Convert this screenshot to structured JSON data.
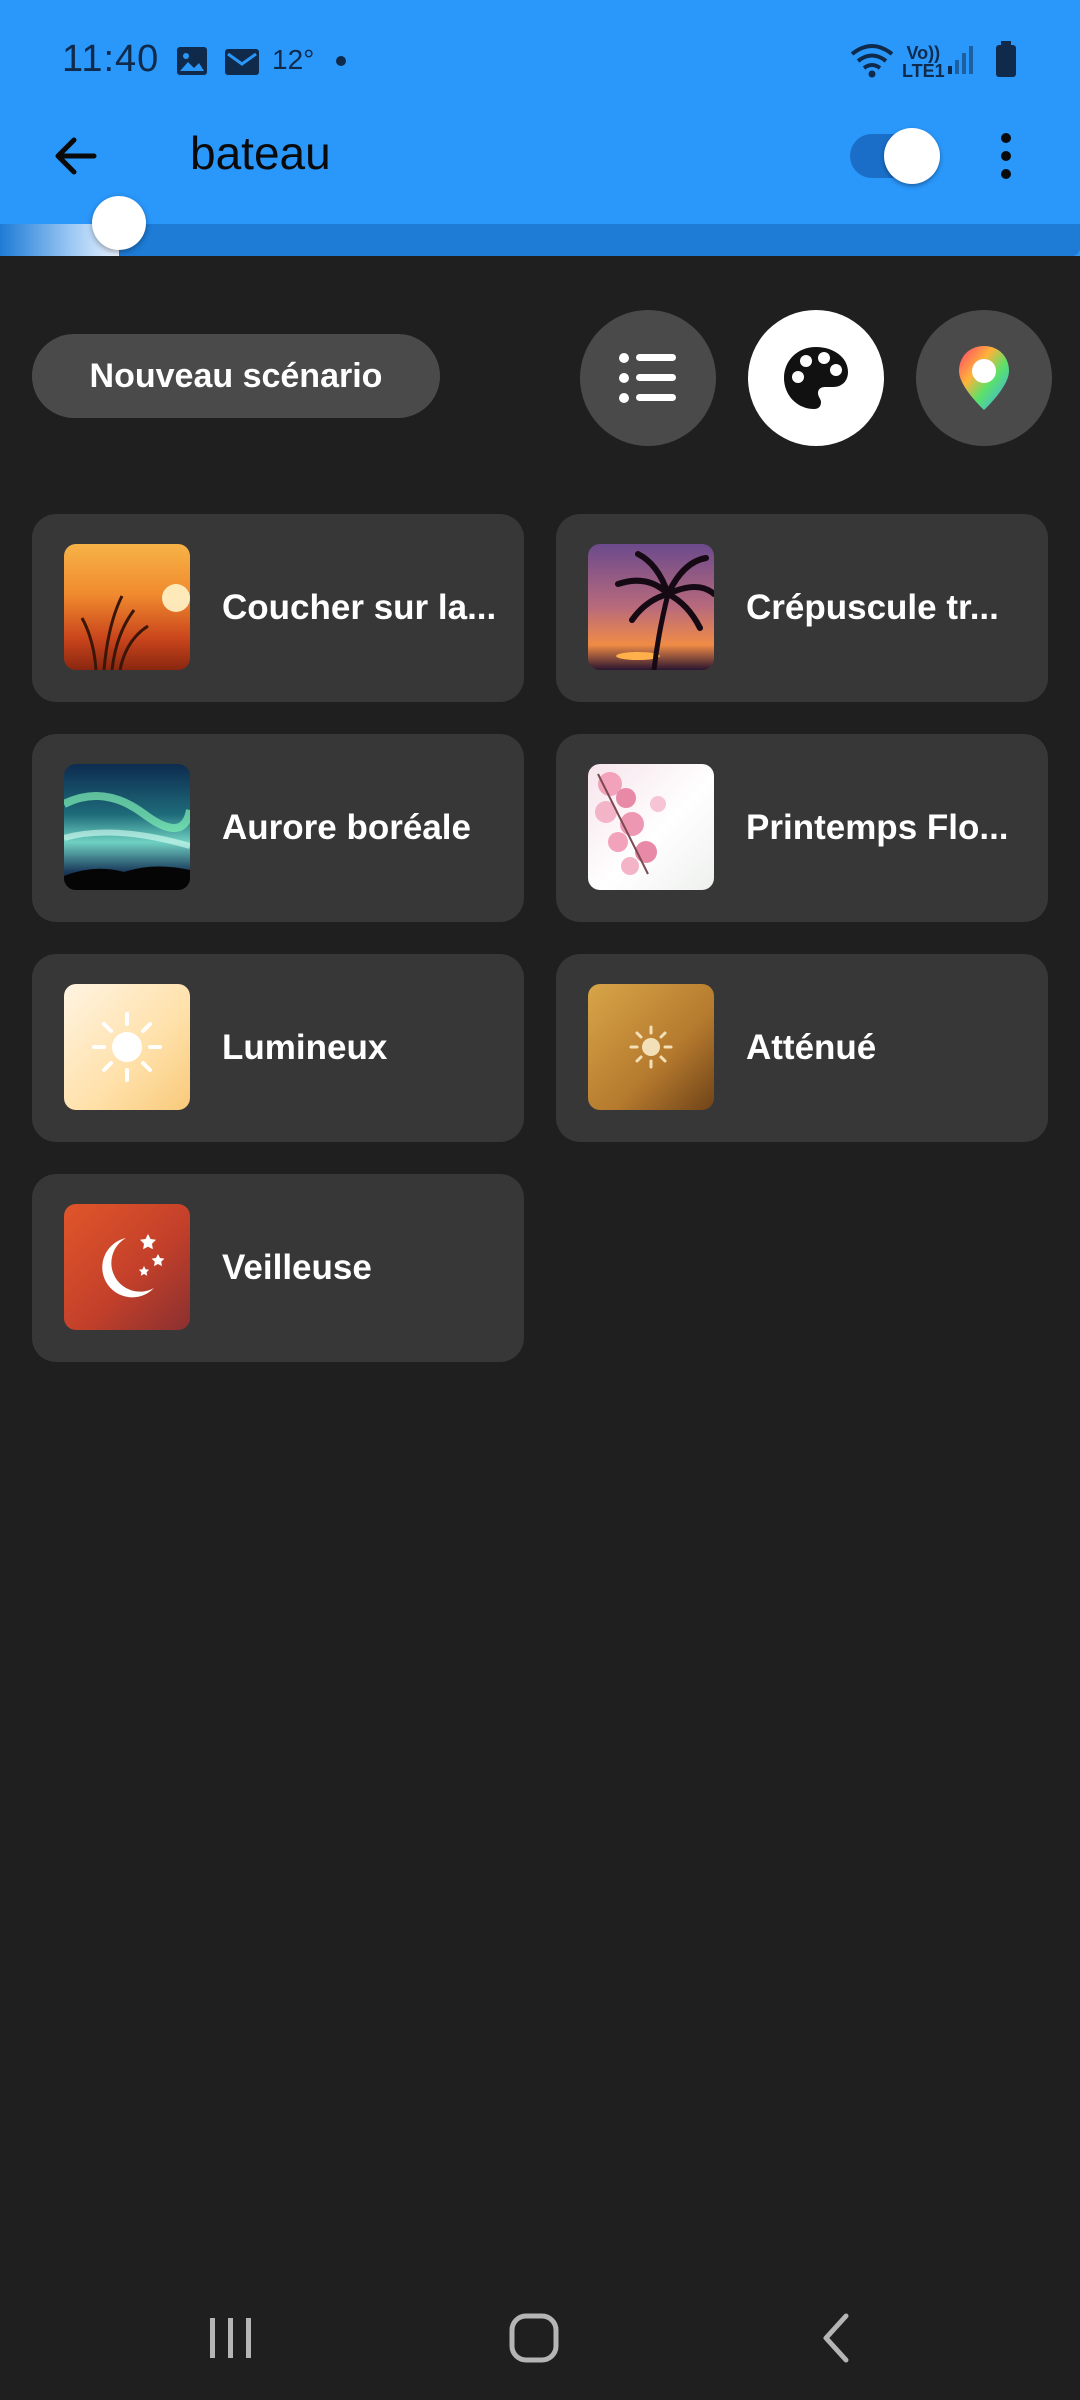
{
  "status_bar": {
    "time": "11:40",
    "temperature": "12°",
    "volte_line1": "Vo))",
    "volte_line2": "LTE1",
    "icons": [
      "image-icon",
      "mail-icon",
      "dot-icon",
      "wifi-icon",
      "signal-icon",
      "battery-icon"
    ]
  },
  "appbar": {
    "title": "bateau",
    "power_on": true,
    "back_icon": "arrow-left-icon",
    "menu_icon": "more-vertical-icon"
  },
  "brightness": {
    "level": 0.11
  },
  "toolbar": {
    "new_scene_label": "Nouveau scénario",
    "buttons": [
      {
        "icon": "list-icon",
        "active": false
      },
      {
        "icon": "palette-icon",
        "active": true
      },
      {
        "icon": "color-pin-icon",
        "active": false
      }
    ]
  },
  "scenes": [
    {
      "label": "Coucher sur la...",
      "thumb": "sunset-grass-photo"
    },
    {
      "label": "Crépuscule tr...",
      "thumb": "palm-dusk-photo"
    },
    {
      "label": "Aurore boréale",
      "thumb": "aurora-photo"
    },
    {
      "label": "Printemps Flo...",
      "thumb": "cherry-blossom-photo"
    },
    {
      "label": "Lumineux",
      "thumb": "bright-sun-icon"
    },
    {
      "label": "Atténué",
      "thumb": "dim-sun-icon"
    },
    {
      "label": "Veilleuse",
      "thumb": "moon-stars-icon"
    }
  ],
  "colors": {
    "header_blue": "#2a97fb",
    "background": "#1f1f1f",
    "card": "#373737",
    "button_gray": "#4a4a4a"
  },
  "navbar": {
    "icons": [
      "recent-apps-icon",
      "home-icon",
      "back-icon"
    ]
  }
}
